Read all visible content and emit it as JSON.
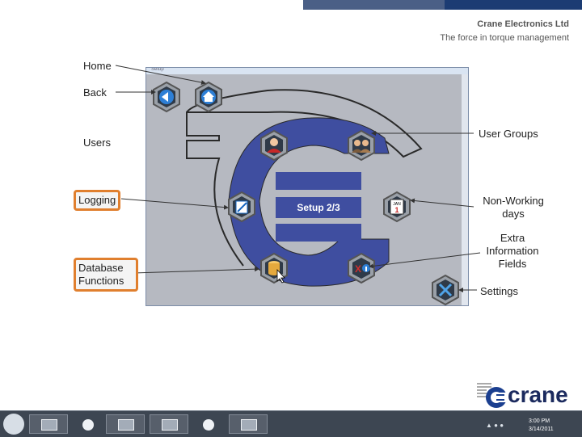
{
  "company": {
    "name": "Crane Electronics Ltd",
    "tagline": "The force in torque management"
  },
  "window": {
    "title": "Setup"
  },
  "setup": {
    "page_label": "Setup 2/3"
  },
  "buttons": {
    "home": "house-icon",
    "back": "back-arrow-icon",
    "users": "user-icon",
    "user_groups": "user-group-icon",
    "logging": "logbook-icon",
    "non_working_days": "calendar-icon",
    "calendar_month": "JAN",
    "calendar_day": "1",
    "database": "database-icon",
    "extra_fields": "xi-icon",
    "settings": "tools-icon"
  },
  "callouts": {
    "home": "Home",
    "back": "Back",
    "users": "Users",
    "logging": "Logging",
    "database": "Database Functions",
    "user_groups": "User Groups",
    "non_working_days": "Non-Working days",
    "extra_fields": "Extra Information Fields",
    "settings": "Settings"
  },
  "colors": {
    "accent_blue": "#3f4ea0",
    "highlight_orange": "#e07f2e",
    "navy": "#1c3c73"
  },
  "logo": {
    "word": "crane"
  },
  "taskbar": {
    "time": "3:00 PM",
    "date": "3/14/2011"
  }
}
